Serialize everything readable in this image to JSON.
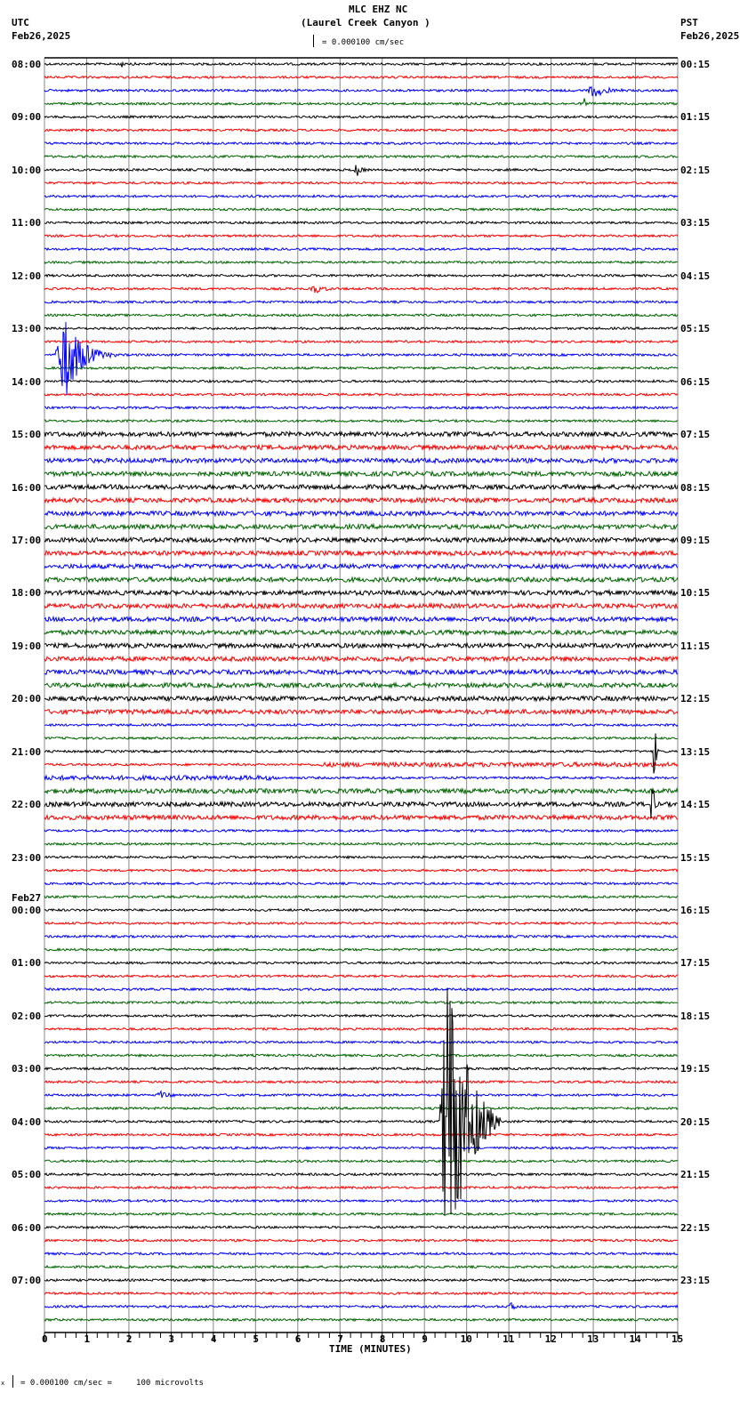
{
  "header": {
    "station": "MLC EHZ NC",
    "location": "(Laurel Creek Canyon )",
    "scale_text": "= 0.000100 cm/sec",
    "left_zone": "UTC",
    "left_date": "Feb26,2025",
    "right_zone": "PST",
    "right_date": "Feb26,2025"
  },
  "footer": {
    "scale_text": "= 0.000100 cm/sec =     100 microvolts",
    "mark": "x"
  },
  "chart_data": {
    "type": "line",
    "title": "MLC EHZ NC (Laurel Creek Canyon )",
    "xlabel": "TIME (MINUTES)",
    "xlim": [
      0,
      15
    ],
    "x_ticks": [
      "0",
      "1",
      "2",
      "3",
      "4",
      "5",
      "6",
      "7",
      "8",
      "9",
      "10",
      "11",
      "12",
      "13",
      "14",
      "15"
    ],
    "grid": true,
    "traces_per_hour": 4,
    "trace_count": 96,
    "trace_colors": [
      "#000000",
      "#ff0000",
      "#0000ff",
      "#006400"
    ],
    "left_labels": [
      "08:00",
      "09:00",
      "10:00",
      "11:00",
      "12:00",
      "13:00",
      "14:00",
      "15:00",
      "16:00",
      "17:00",
      "18:00",
      "19:00",
      "20:00",
      "21:00",
      "22:00",
      "23:00",
      "00:00",
      "01:00",
      "02:00",
      "03:00",
      "04:00",
      "05:00",
      "06:00",
      "07:00"
    ],
    "date_change_label": "Feb27",
    "date_change_hour_index": 16,
    "right_labels": [
      "00:15",
      "01:15",
      "02:15",
      "03:15",
      "04:15",
      "05:15",
      "06:15",
      "07:15",
      "08:15",
      "09:15",
      "10:15",
      "11:15",
      "12:15",
      "13:15",
      "14:15",
      "15:15",
      "16:15",
      "17:15",
      "18:15",
      "19:15",
      "20:15",
      "21:15",
      "22:15",
      "23:15"
    ],
    "noise_level_default": 1.3,
    "noise_level_high_rows": [
      28,
      29,
      30,
      31,
      32,
      33,
      34,
      35,
      36,
      37,
      38,
      39,
      40,
      41,
      42,
      43,
      44,
      45,
      46,
      47,
      48,
      49,
      55,
      56,
      57
    ],
    "noise_level_high": 2.6,
    "events": [
      {
        "row": 0,
        "start_min": 1.7,
        "end_min": 2.5,
        "amplitude": 3
      },
      {
        "row": 2,
        "start_min": 12.85,
        "end_min": 13.8,
        "amplitude": 9
      },
      {
        "row": 3,
        "start_min": 12.75,
        "end_min": 12.95,
        "amplitude": 6
      },
      {
        "row": 8,
        "start_min": 7.3,
        "end_min": 7.9,
        "amplitude": 7
      },
      {
        "row": 17,
        "start_min": 6.3,
        "end_min": 7.0,
        "amplitude": 7
      },
      {
        "row": 22,
        "start_min": 0.25,
        "end_min": 1.7,
        "amplitude": 55
      },
      {
        "row": 52,
        "start_min": 14.42,
        "end_min": 14.55,
        "amplitude": 60
      },
      {
        "row": 56,
        "start_min": 14.35,
        "end_min": 14.55,
        "amplitude": 40
      },
      {
        "row": 64,
        "start_min": 14.0,
        "end_min": 14.1,
        "amplitude": 8
      },
      {
        "row": 78,
        "start_min": 2.65,
        "end_min": 3.4,
        "amplitude": 4
      },
      {
        "row": 80,
        "start_min": 9.35,
        "end_min": 10.8,
        "amplitude": 230
      },
      {
        "row": 94,
        "start_min": 11.0,
        "end_min": 11.3,
        "amplitude": 6
      }
    ]
  }
}
